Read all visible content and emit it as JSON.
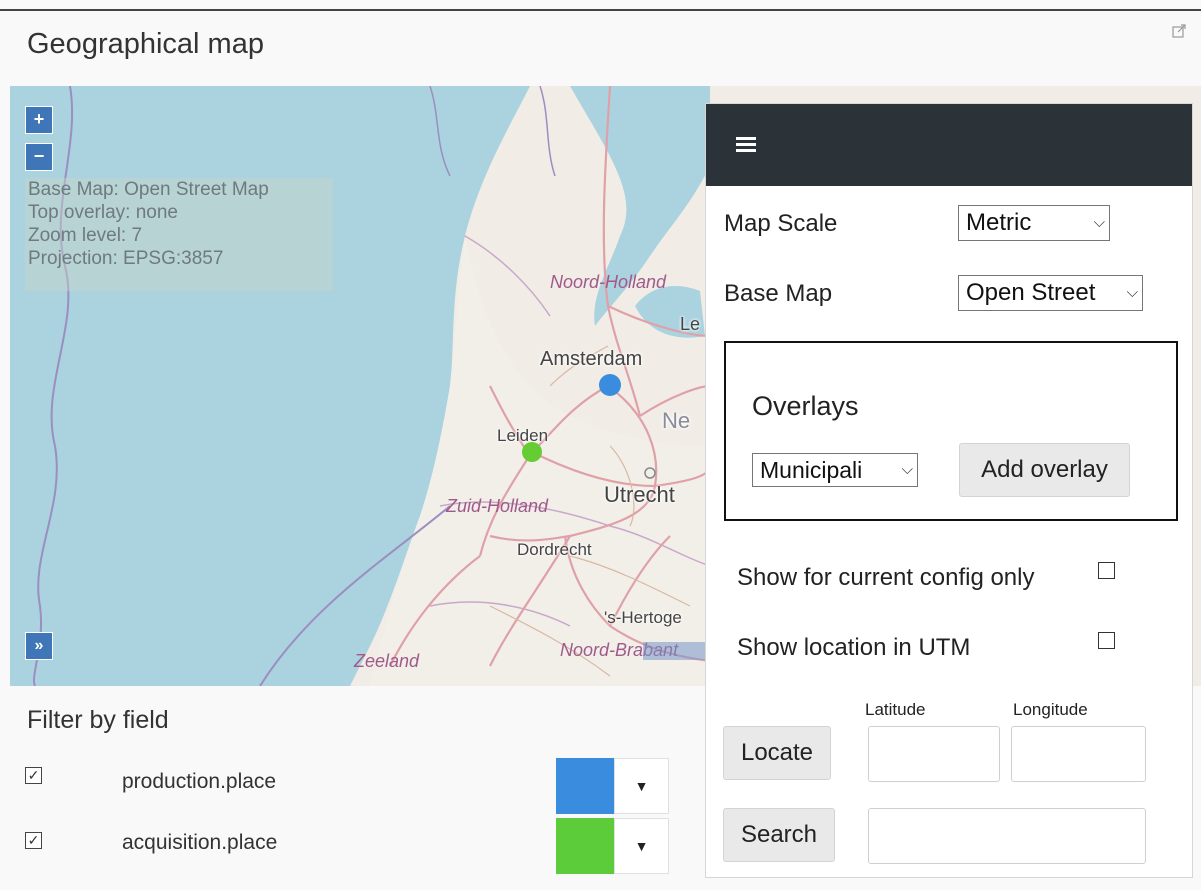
{
  "title": "Geographical map",
  "map": {
    "zoom_in": "+",
    "zoom_out": "−",
    "info": {
      "base_map": "Base Map: Open Street Map",
      "top_overlay": "Top overlay: none",
      "zoom_level": "Zoom level: 7",
      "projection": "Projection: EPSG:3857"
    },
    "expand": "»",
    "labels": {
      "noord_holland": "Noord-Holland",
      "le": "Le",
      "amsterdam": "Amsterdam",
      "ne": "Ne",
      "leiden": "Leiden",
      "zuid_holland": "Zuid-Holland",
      "utrecht": "Utrecht",
      "dordrecht": "Dordrecht",
      "hertoge": "'s-Hertoge",
      "noord_brabant": "Noord-Brabant",
      "zeeland": "Zeeland"
    },
    "markers": [
      {
        "name": "production.place",
        "color": "#3a8dde"
      },
      {
        "name": "acquisition.place",
        "color": "#66cc33"
      }
    ]
  },
  "panel": {
    "map_scale_label": "Map Scale",
    "map_scale_value": "Metric",
    "base_map_label": "Base Map",
    "base_map_value": "Open Street",
    "overlays_title": "Overlays",
    "overlay_select_value": "Municipali",
    "add_overlay": "Add overlay",
    "show_current_config": "Show for current config only",
    "show_current_config_checked": false,
    "show_utm": "Show location in UTM",
    "show_utm_checked": false,
    "latitude_label": "Latitude",
    "longitude_label": "Longitude",
    "latitude_value": "",
    "longitude_value": "",
    "locate": "Locate",
    "search": "Search",
    "search_value": ""
  },
  "filter": {
    "title": "Filter by field",
    "fields": [
      {
        "label": "production.place",
        "checked": true,
        "color": "#3a8dde"
      },
      {
        "label": "acquisition.place",
        "checked": true,
        "color": "#5ccc3a"
      }
    ],
    "dropdown_icon": "▼"
  },
  "icons": {
    "external_link": "external-link-icon",
    "hamburger": "hamburger-menu-icon",
    "checkmark": "☑"
  }
}
